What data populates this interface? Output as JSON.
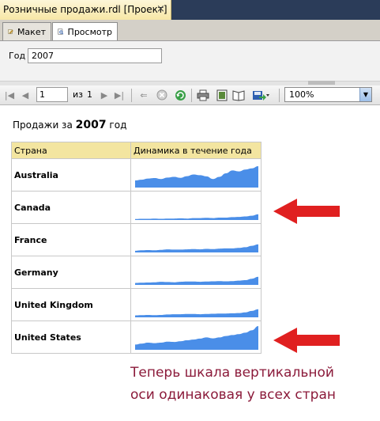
{
  "window": {
    "title": "Розничные продажи.rdl [Проект]",
    "close": "×"
  },
  "tabs": [
    {
      "label": "Макет"
    },
    {
      "label": "Просмотр"
    }
  ],
  "parameters": {
    "label": "Год",
    "value": "2007"
  },
  "toolbar": {
    "page_value": "1",
    "of_label": "из",
    "total_pages": "1",
    "zoom": "100%"
  },
  "report": {
    "title_prefix": "Продажи за",
    "year": "2007",
    "title_suffix": "год",
    "col_country": "Страна",
    "col_trend": "Динамика в течение года",
    "rows": [
      {
        "country": "Australia",
        "trend": [
          0.3,
          0.33,
          0.38,
          0.4,
          0.36,
          0.42,
          0.45,
          0.41,
          0.48,
          0.55,
          0.52,
          0.47,
          0.36,
          0.45,
          0.6,
          0.72,
          0.68,
          0.76,
          0.81,
          0.9
        ]
      },
      {
        "country": "Canada",
        "trend": [
          0.04,
          0.05,
          0.05,
          0.06,
          0.05,
          0.06,
          0.06,
          0.07,
          0.06,
          0.08,
          0.08,
          0.09,
          0.08,
          0.1,
          0.1,
          0.12,
          0.13,
          0.15,
          0.18,
          0.24
        ]
      },
      {
        "country": "France",
        "trend": [
          0.07,
          0.09,
          0.1,
          0.09,
          0.11,
          0.13,
          0.12,
          0.12,
          0.13,
          0.14,
          0.13,
          0.15,
          0.14,
          0.16,
          0.17,
          0.17,
          0.19,
          0.22,
          0.28,
          0.34
        ]
      },
      {
        "country": "Germany",
        "trend": [
          0.08,
          0.09,
          0.1,
          0.11,
          0.13,
          0.12,
          0.11,
          0.13,
          0.14,
          0.14,
          0.13,
          0.14,
          0.15,
          0.16,
          0.15,
          0.16,
          0.18,
          0.2,
          0.26,
          0.34
        ]
      },
      {
        "country": "United Kingdom",
        "trend": [
          0.08,
          0.09,
          0.1,
          0.09,
          0.1,
          0.12,
          0.13,
          0.13,
          0.14,
          0.14,
          0.13,
          0.14,
          0.15,
          0.16,
          0.16,
          0.17,
          0.18,
          0.21,
          0.27,
          0.34
        ]
      },
      {
        "country": "United States",
        "trend": [
          0.22,
          0.26,
          0.3,
          0.28,
          0.3,
          0.34,
          0.33,
          0.36,
          0.4,
          0.43,
          0.47,
          0.52,
          0.48,
          0.52,
          0.58,
          0.62,
          0.66,
          0.72,
          0.82,
          1.0
        ]
      }
    ]
  },
  "annotation": {
    "line1": "Теперь шкала вертикальной",
    "line2": "оси одинаковая у всех стран"
  },
  "colors": {
    "spark": "#4a8ee8",
    "arrow": "#e02020",
    "note": "#8b1a3a",
    "header": "#f3e5a0"
  }
}
